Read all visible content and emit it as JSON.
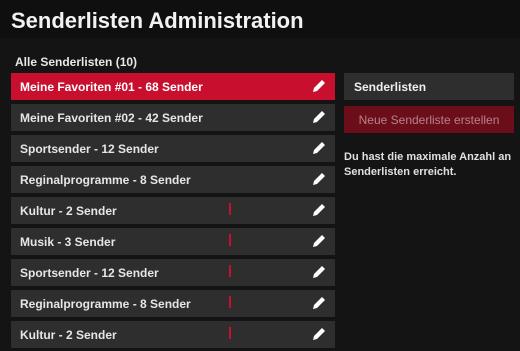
{
  "header": {
    "title": "Senderlisten Administration"
  },
  "list": {
    "heading": "Alle Senderlisten (10)",
    "items": [
      {
        "label": "Meine Favoriten #01 - 68 Sender",
        "selected": true,
        "marker": false,
        "icon": "pencil-icon"
      },
      {
        "label": "Meine Favoriten #02 - 42 Sender",
        "selected": false,
        "marker": false,
        "icon": "pencil-icon"
      },
      {
        "label": "Sportsender - 12 Sender",
        "selected": false,
        "marker": false,
        "icon": "pencil-icon"
      },
      {
        "label": "Reginalprogramme - 8 Sender",
        "selected": false,
        "marker": false,
        "icon": "pencil-icon"
      },
      {
        "label": "Kultur - 2 Sender",
        "selected": false,
        "marker": true,
        "icon": "pencil-icon"
      },
      {
        "label": "Musik - 3 Sender",
        "selected": false,
        "marker": true,
        "icon": "pencil-icon"
      },
      {
        "label": "Sportsender - 12 Sender",
        "selected": false,
        "marker": true,
        "icon": "pencil-icon"
      },
      {
        "label": "Reginalprogramme - 8 Sender",
        "selected": false,
        "marker": true,
        "icon": "pencil-icon"
      },
      {
        "label": "Kultur - 2 Sender",
        "selected": false,
        "marker": true,
        "icon": "pencil-icon"
      }
    ]
  },
  "sidebar": {
    "heading": "Senderlisten",
    "create_button_label": "Neue Senderliste erstellen",
    "info_text": "Du hast die maximale Anzahl an Senderlisten erreicht."
  },
  "colors": {
    "accent": "#c8102e",
    "accent_disabled": "#6b0e19",
    "row_bg": "#2e2e2e",
    "page_bg": "#141414"
  }
}
